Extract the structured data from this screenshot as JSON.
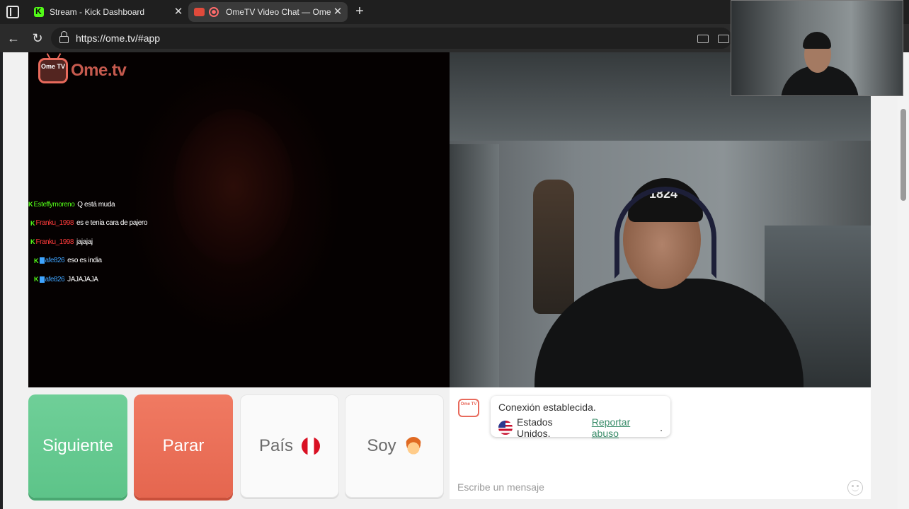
{
  "browser": {
    "tabs": [
      {
        "title": "Stream - Kick Dashboard",
        "icon": "kick-favicon"
      },
      {
        "title": "OmeTV Video Chat — Omeg",
        "icon": "ometv-favicon"
      }
    ],
    "close_glyph": "✕",
    "new_tab_glyph": "+",
    "back_glyph": "←",
    "reload_glyph": "↻",
    "url": "https://ome.tv/#app"
  },
  "app": {
    "logo_badge": "Ome TV",
    "logo_word": "Ome.tv",
    "stream_chat": [
      {
        "user": "Esteffymoreno",
        "user_color": "#53fc18",
        "message": "Q está muda",
        "badge": false
      },
      {
        "user": "Franku_1998",
        "user_color": "#ff3b3b",
        "message": "es e tenia cara de pajero",
        "badge": false
      },
      {
        "user": "Franku_1998",
        "user_color": "#ff3b3b",
        "message": "jajajaj",
        "badge": false
      },
      {
        "user": "afe826",
        "user_color": "#3ea4ff",
        "message": "eso es india",
        "badge": true
      },
      {
        "user": "afe826",
        "user_color": "#3ea4ff",
        "message": "JAJAJAJA",
        "badge": true
      }
    ],
    "cap_text": "1824",
    "controls": {
      "next": "Siguiente",
      "stop": "Parar",
      "country": "País",
      "gender": "Soy"
    },
    "chat": {
      "logo_badge": "Ome TV",
      "connection": "Conexión establecida.",
      "country": "Estados Unidos.",
      "report": "Reportar abuso",
      "report_suffix": ".",
      "placeholder": "Escribe un mensaje"
    },
    "colors": {
      "next": "#6fcf98",
      "stop": "#f07a62",
      "brand": "#e86a5c",
      "link": "#3a8d6a"
    }
  }
}
